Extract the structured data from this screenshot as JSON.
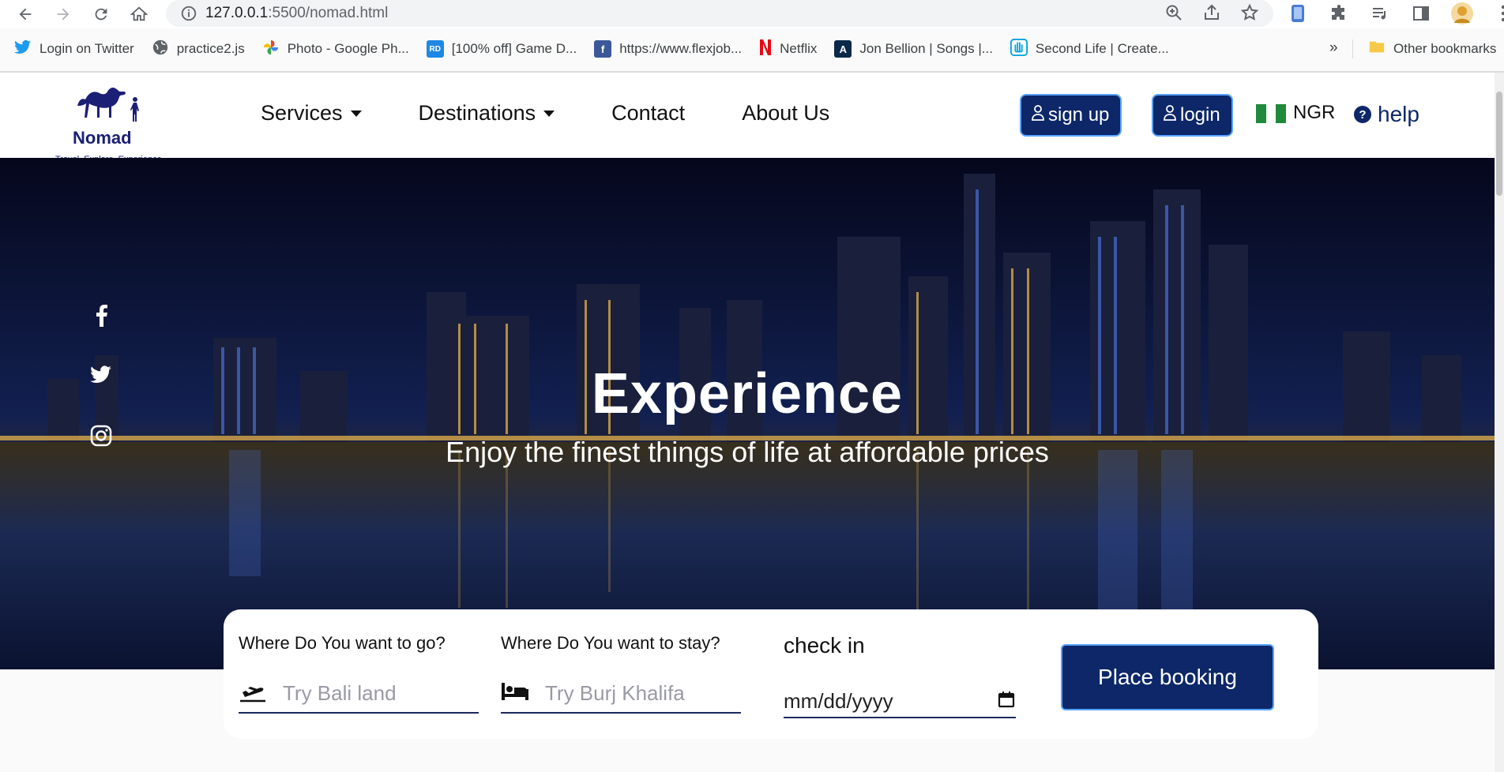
{
  "browser": {
    "url_host": "127.0.0.1",
    "url_rest": ":5500/nomad.html",
    "bookmarks": [
      {
        "label": "Login on Twitter",
        "icon": "twitter-icon",
        "color": "#1d9bf0"
      },
      {
        "label": "practice2.js",
        "icon": "globe-icon",
        "color": "#5f6368"
      },
      {
        "label": "Photo - Google Ph...",
        "icon": "google-photos-icon",
        "color": "#fbbc04"
      },
      {
        "label": "[100% off] Game D...",
        "icon": "rd-icon",
        "color": "#1e88e5"
      },
      {
        "label": "https://www.flexjob...",
        "icon": "flexjobs-icon",
        "color": "#3b5998"
      },
      {
        "label": "Netflix",
        "icon": "netflix-icon",
        "color": "#e50914"
      },
      {
        "label": "Jon Bellion | Songs |...",
        "icon": "jon-bellion-icon",
        "color": "#0b2a4a"
      },
      {
        "label": "Second Life | Create...",
        "icon": "second-life-icon",
        "color": "#00a3e0"
      }
    ],
    "overflow_label": "»",
    "other_bookmarks": "Other bookmarks"
  },
  "header": {
    "logo_word": "Nomad",
    "logo_tagline": "Travel. Explore. Experience.",
    "nav": [
      "Services",
      "Destinations",
      "Contact",
      "About Us"
    ],
    "signup_label": "sign up",
    "login_label": "login",
    "currency": "NGR",
    "help_label": "help",
    "help_glyph": "?"
  },
  "hero": {
    "title": "Experience",
    "subtitle": "Enjoy the finest things of life at affordable prices",
    "social": [
      "facebook-icon",
      "twitter-icon",
      "instagram-icon"
    ]
  },
  "booking": {
    "go_label": "Where Do You want to go?",
    "go_placeholder": "Try Bali land",
    "stay_label": "Where Do You want to stay?",
    "stay_placeholder": "Try Burj Khalifa",
    "checkin_label": "check in",
    "date_placeholder": "mm/dd/yyyy",
    "submit_label": "Place booking"
  },
  "colors": {
    "brand_navy": "#0d2768",
    "logo_navy": "#1b1f75",
    "button_border": "#5aa3ff"
  }
}
